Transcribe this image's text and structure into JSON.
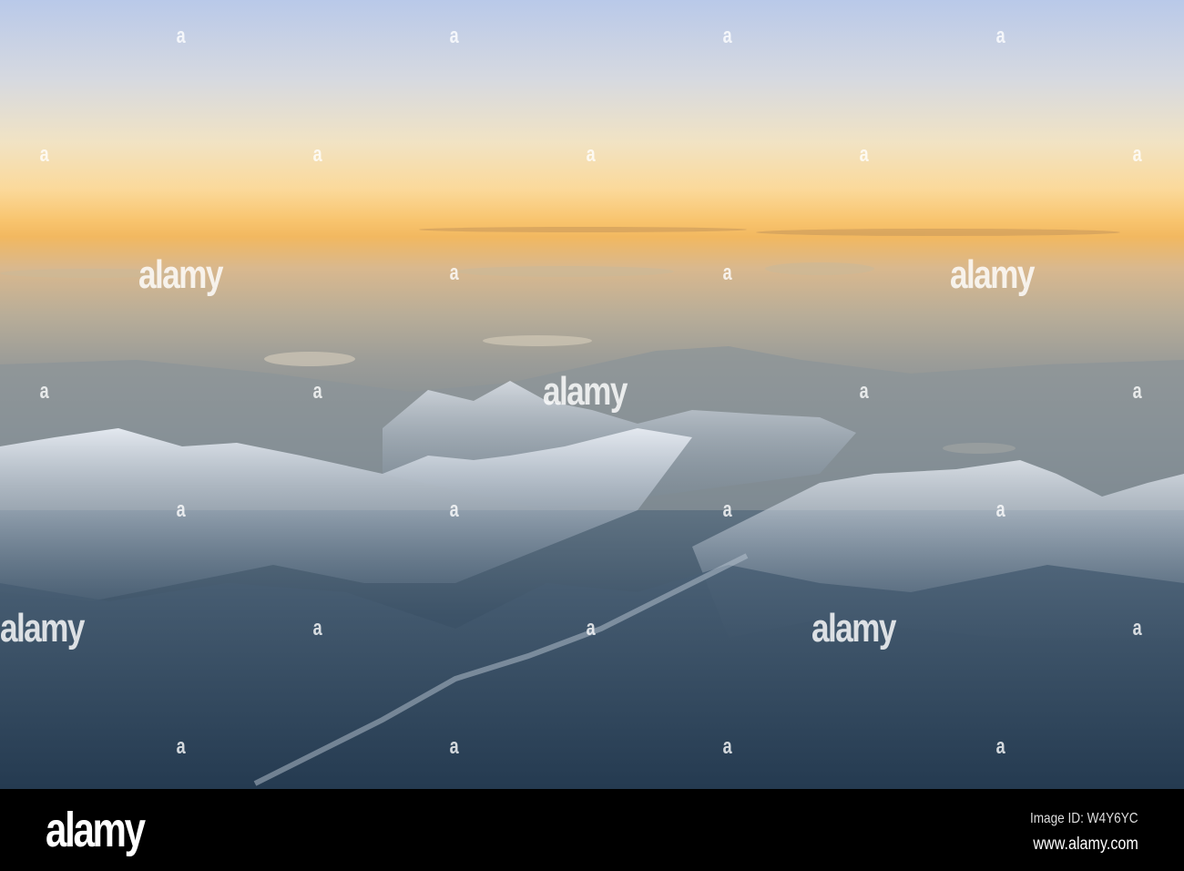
{
  "watermark": {
    "word": "alamy",
    "letter": "a"
  },
  "footer": {
    "logo": "alamy",
    "image_id": "Image ID: W4Y6YC",
    "website": "www.alamy.com"
  },
  "colors": {
    "sky_top": "#b9c9e9",
    "horizon": "#f8c46e",
    "haze": "#9b9c98",
    "valley": "#2a3f55",
    "snow": "#dfe6ef"
  }
}
